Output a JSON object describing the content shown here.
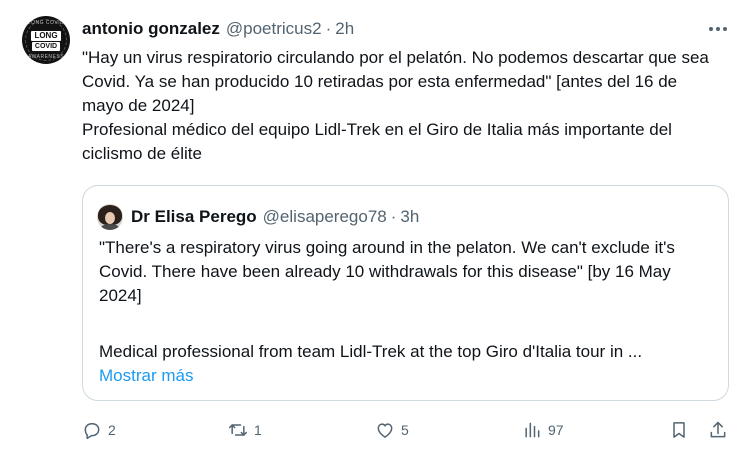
{
  "author": {
    "name": "antonio gonzalez",
    "handle": "@poetricus2",
    "separator": "·",
    "time": "2h",
    "avatar": {
      "ring_top": "LONG COVID",
      "ring_bottom": "AWARENESS",
      "badge_line1": "LONG",
      "badge_line2": "COVID"
    }
  },
  "tweet": {
    "text": "\"Hay un virus respiratorio circulando por el pelatón. No podemos descartar que sea Covid. Ya se han producido 10 retiradas por esta enfermedad\" [antes del 16 de mayo de 2024]\nProfesional médico del equipo Lidl-Trek en el Giro de Italia más importante del ciclismo de élite"
  },
  "quote": {
    "name": "Dr Elisa Perego",
    "handle": "@elisaperego78",
    "separator": "·",
    "time": "3h",
    "text": "\"There's a respiratory virus going around in the pelaton. We can't exclude it's Covid. There have been already 10 withdrawals for this disease\" [by 16 May 2024]",
    "text2": "Medical professional from team Lidl-Trek at the top Giro d'Italia tour in ...",
    "show_more": "Mostrar más"
  },
  "actions": {
    "reply_count": "2",
    "retweet_count": "1",
    "like_count": "5",
    "views_count": "97"
  },
  "icons": [
    "more-icon",
    "reply-icon",
    "retweet-icon",
    "like-icon",
    "views-icon",
    "bookmark-icon",
    "share-icon"
  ],
  "colors": {
    "text": "#0f1419",
    "secondary": "#536471",
    "link": "#1d9bf0",
    "border": "#cfd9de"
  }
}
